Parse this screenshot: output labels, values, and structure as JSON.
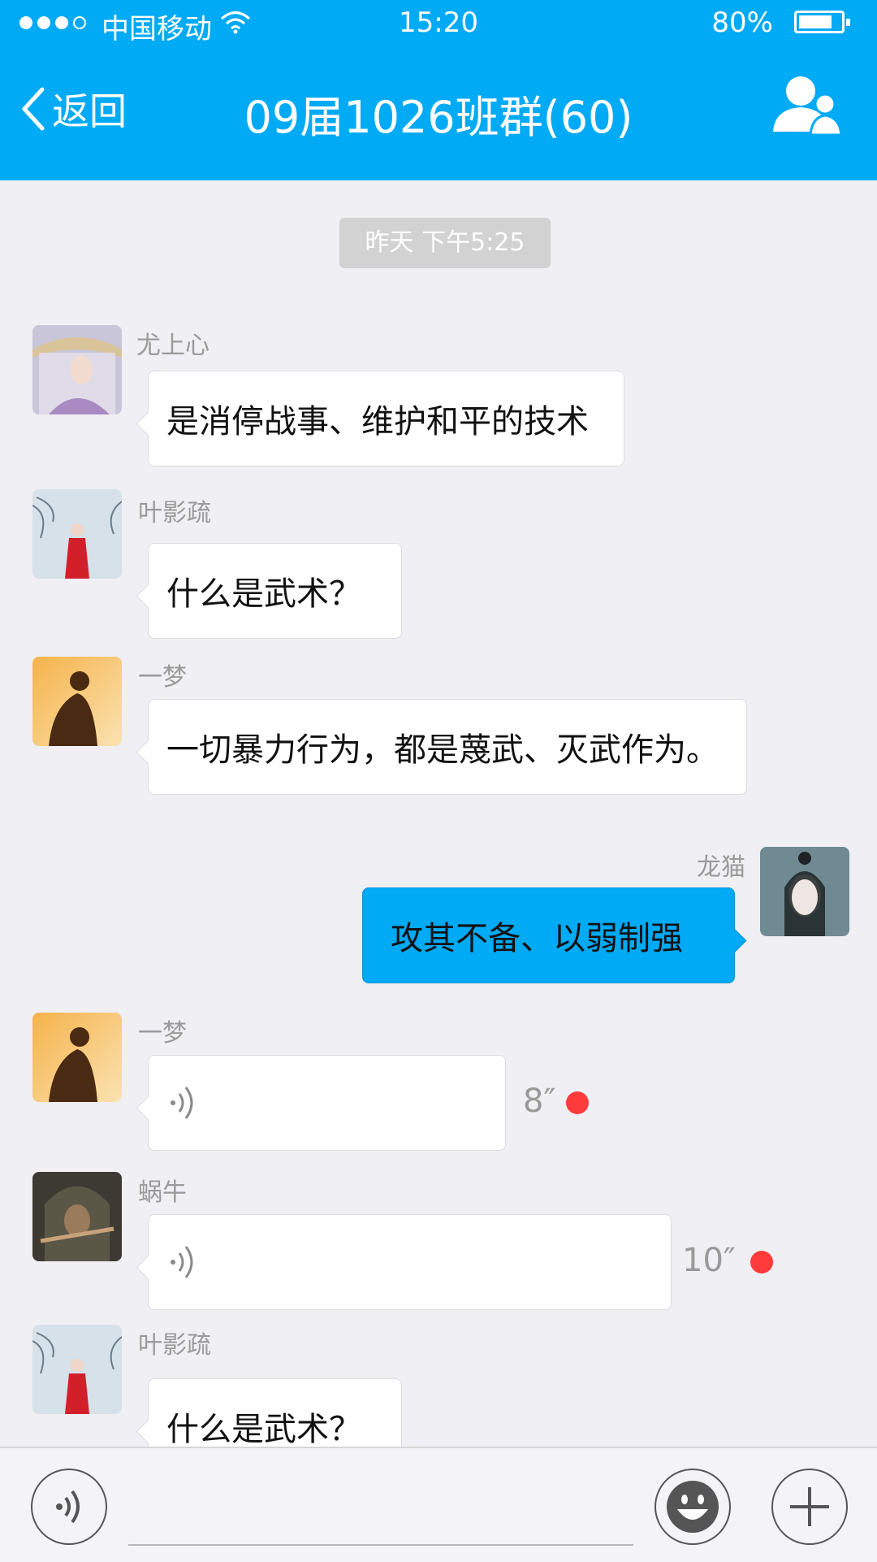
{
  "status": {
    "carrier": "中国移动",
    "time": "15:20",
    "battery": "80%",
    "battery_level": 0.8
  },
  "header": {
    "back_label": "返回",
    "title": "09届1026班群(60)"
  },
  "chat": {
    "timestamp": "昨天 下午5:25",
    "messages": [
      {
        "sender": "尤上心",
        "text": "是消停战事、维护和平的技术"
      },
      {
        "sender": "叶影疏",
        "text": "什么是武术？"
      },
      {
        "sender": "一梦",
        "text": "一切暴力行为，都是蔑武、灭武作为。"
      },
      {
        "sender": "龙猫",
        "text": "攻其不备、以弱制强"
      },
      {
        "sender": "一梦",
        "duration": "8″"
      },
      {
        "sender": "蜗牛",
        "duration": "10″"
      },
      {
        "sender": "叶影疏",
        "text": "什么是武术？"
      }
    ]
  },
  "colors": {
    "accent": "#00aaf5",
    "unread": "#ff3b3b",
    "background": "#efeff4"
  },
  "icons": [
    "back-chevron-icon",
    "wifi-icon",
    "members-icon",
    "voice-icon",
    "emoji-icon",
    "plus-icon"
  ]
}
